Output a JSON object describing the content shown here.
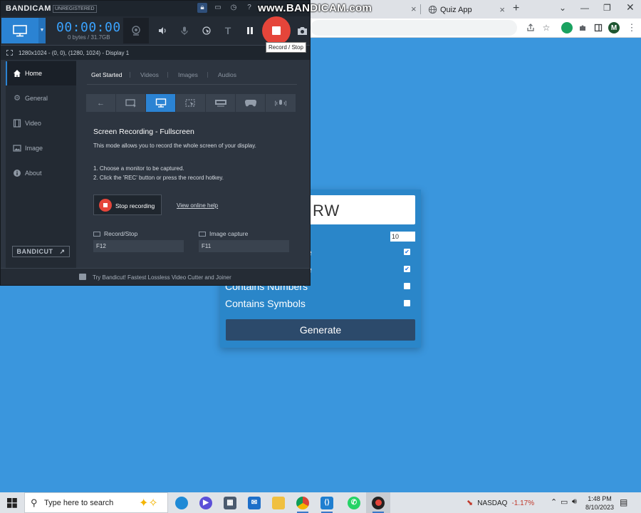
{
  "browser": {
    "tab_title": "Quiz App",
    "new_tab_symbol": "+",
    "close_symbol": "×"
  },
  "quiz": {
    "password_partial": "RW",
    "length_value": "10",
    "options": [
      {
        "label": "",
        "checked": true
      },
      {
        "label": "",
        "checked": true
      },
      {
        "label": "Contains Numbers",
        "checked": false
      },
      {
        "label": "Contains Symbols",
        "checked": false
      }
    ],
    "partial_label_suffix_1": "e",
    "partial_label_suffix_2": "e",
    "generate_label": "Generate"
  },
  "bandicam": {
    "logo": "BANDICAM",
    "license": "UNREGISTERED",
    "watermark": "www.BANDICAM.com",
    "timer": "00:00:00",
    "size": "0 bytes / 31.7GB",
    "tooltip": "Record / Stop",
    "region": "1280x1024 - (0, 0), (1280, 1024) - Display 1",
    "nav": [
      {
        "label": "Home",
        "icon": "home-icon",
        "active": true
      },
      {
        "label": "General",
        "icon": "gear-icon",
        "active": false
      },
      {
        "label": "Video",
        "icon": "video-icon",
        "active": false
      },
      {
        "label": "Image",
        "icon": "image-icon",
        "active": false
      },
      {
        "label": "About",
        "icon": "info-icon",
        "active": false
      }
    ],
    "bandicut_label": "BANDICUT",
    "tabs": [
      "Get Started",
      "Videos",
      "Images",
      "Audios"
    ],
    "mode_title": "Screen Recording - Fullscreen",
    "mode_desc": "This mode allows you to record the whole screen of your display.",
    "step1": "1. Choose a monitor to be captured.",
    "step2": "2. Click the 'REC' button or press the record hotkey.",
    "stop_label": "Stop recording",
    "help_link": "View online help",
    "hotkeys": [
      {
        "label": "Record/Stop",
        "value": "F12"
      },
      {
        "label": "Image capture",
        "value": "F11"
      }
    ],
    "footer": "Try Bandicut! Fastest Lossless Video Cutter and Joiner"
  },
  "taskbar": {
    "search_placeholder": "Type here to search",
    "nasdaq_label": "NASDAQ",
    "nasdaq_change": "-1.17%",
    "time": "1:48 PM",
    "date": "8/10/2023"
  },
  "colors": {
    "desktop_blue": "#3a96dd",
    "bandicam_accent": "#2b83d3",
    "record_red": "#e5453a",
    "quiz_card": "#2a86c9",
    "generate_button": "#2c4a6b"
  }
}
